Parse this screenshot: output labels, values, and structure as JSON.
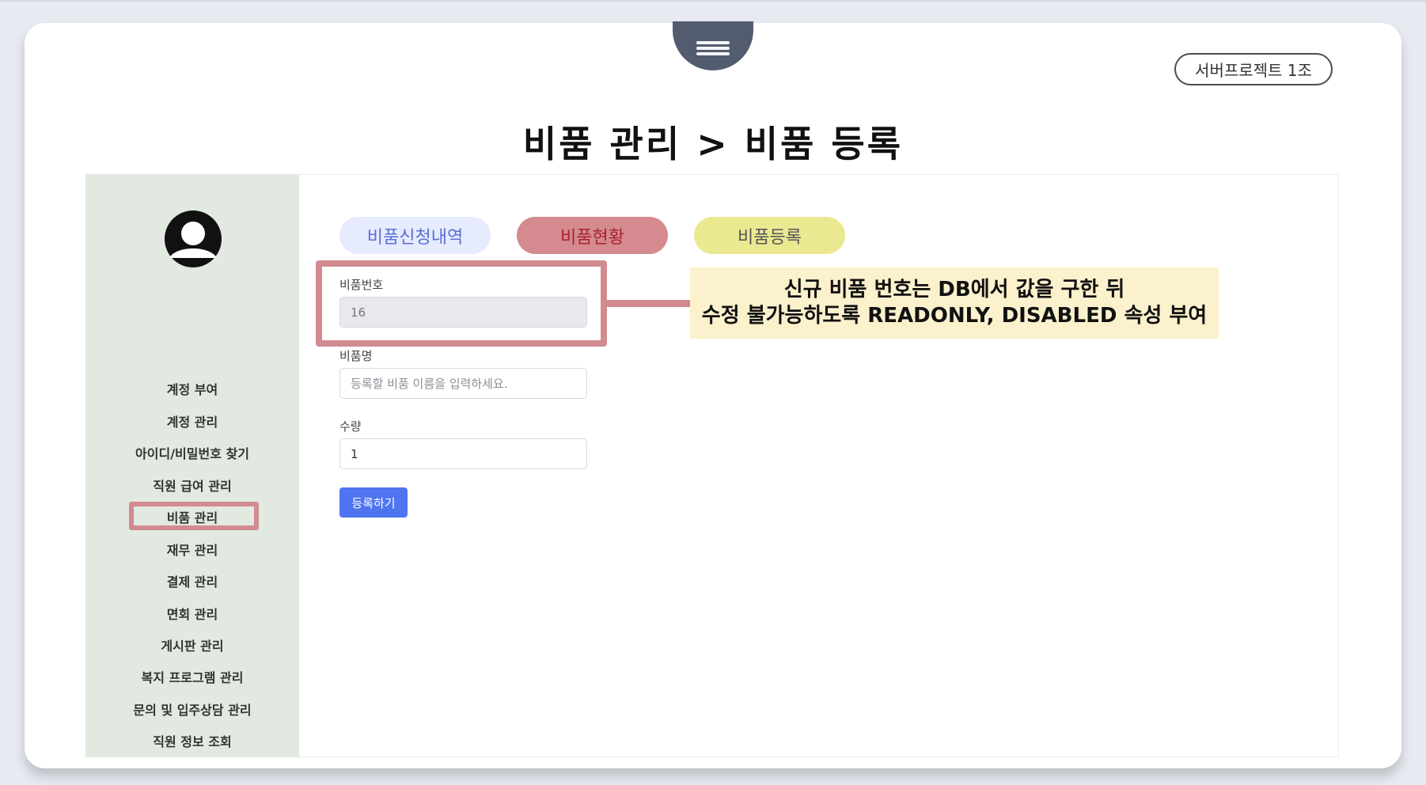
{
  "badge": "서버프로젝트 1조",
  "page_title": "비품 관리 > 비품 등록",
  "sidebar": {
    "items": [
      {
        "label": "계정 부여"
      },
      {
        "label": "계정 관리"
      },
      {
        "label": "아이디/비밀번호 찾기"
      },
      {
        "label": "직원 급여 관리"
      },
      {
        "label": "비품 관리"
      },
      {
        "label": "재무 관리"
      },
      {
        "label": "결제 관리"
      },
      {
        "label": "면회 관리"
      },
      {
        "label": "게시판 관리"
      },
      {
        "label": "복지 프로그램 관리"
      },
      {
        "label": "문의 및 입주상담 관리"
      },
      {
        "label": "직원 정보 조회"
      }
    ],
    "active_item": "비품 관리"
  },
  "tabs": [
    {
      "label": "비품신청내역",
      "bg": "#e6ebfd",
      "fg": "#5b6ed6"
    },
    {
      "label": "비품현황",
      "bg": "#d48a8f",
      "fg": "#a8232e"
    },
    {
      "label": "비품등록",
      "bg": "#ebe892",
      "fg": "#555555"
    }
  ],
  "form": {
    "item_number": {
      "label": "비품번호",
      "value": "16"
    },
    "item_name": {
      "label": "비품명",
      "placeholder": "등록할 비품 이름을 입력하세요."
    },
    "quantity": {
      "label": "수량",
      "value": "1"
    },
    "submit_label": "등록하기"
  },
  "callout": {
    "line1": "신규 비품 번호는 DB에서 값을 구한 뒤",
    "line2": "수정 불가능하도록 READONLY, DISABLED 속성 부여"
  },
  "colors": {
    "highlight": "#d18b90",
    "sidebar_bg": "#e1e9e1",
    "callout_bg": "#fcf1cd",
    "button": "#4e74f0"
  },
  "icons": {
    "menu": "hamburger-icon",
    "avatar": "user-avatar-icon"
  }
}
